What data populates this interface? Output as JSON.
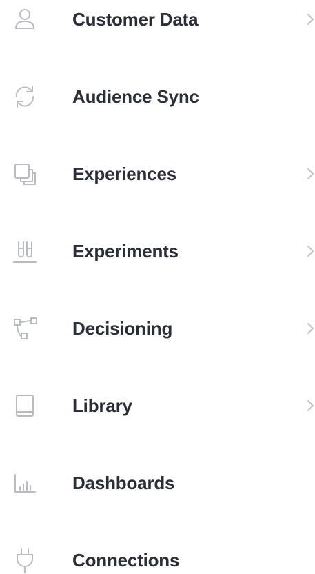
{
  "nav": {
    "items": [
      {
        "label": "Customer Data",
        "icon": "person-icon",
        "has_chevron": true
      },
      {
        "label": "Audience Sync",
        "icon": "sync-icon",
        "has_chevron": false
      },
      {
        "label": "Experiences",
        "icon": "layers-icon",
        "has_chevron": true
      },
      {
        "label": "Experiments",
        "icon": "test-tubes-icon",
        "has_chevron": true
      },
      {
        "label": "Decisioning",
        "icon": "flow-icon",
        "has_chevron": true
      },
      {
        "label": "Library",
        "icon": "book-icon",
        "has_chevron": true
      },
      {
        "label": "Dashboards",
        "icon": "bar-chart-icon",
        "has_chevron": false
      },
      {
        "label": "Connections",
        "icon": "plug-icon",
        "has_chevron": false
      }
    ]
  },
  "colors": {
    "label": "#2a2e37",
    "icon": "#b8bcc2",
    "chevron": "#c3c6cb",
    "background": "#ffffff"
  }
}
